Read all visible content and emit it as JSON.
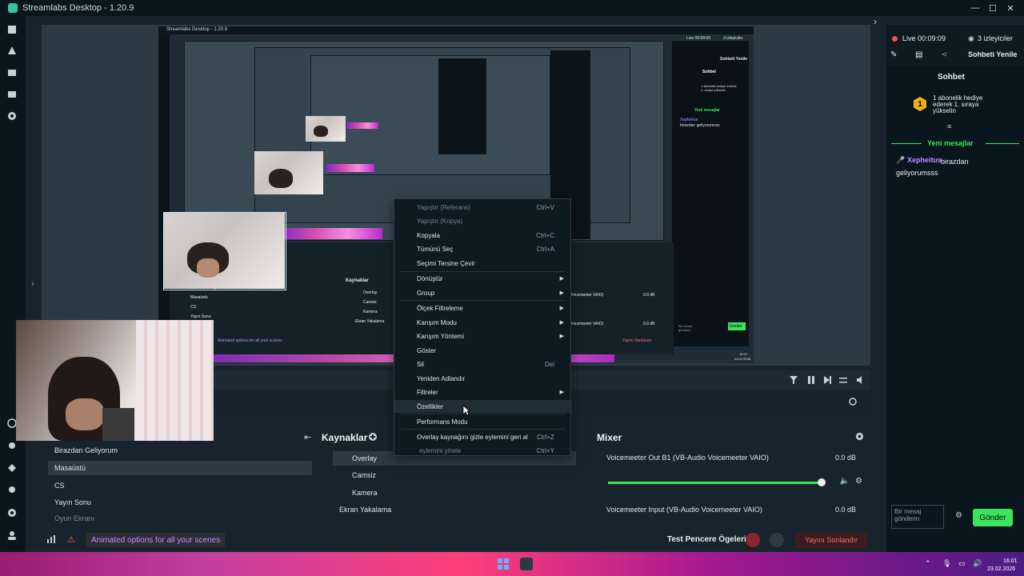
{
  "window": {
    "title": "Streamlabs Desktop - 1.20.9",
    "controls": [
      "—",
      "☐",
      "✕"
    ]
  },
  "nested_preview": {
    "title": "Streamlabs Desktop - 1.20.9",
    "chat_title": "Sohbet",
    "new_messages": "Yeni mesajlar",
    "message_user": "Xepheitus",
    "message_text": "birazdan geliyorumsss",
    "sources_title": "Kaynaklar",
    "sources": [
      "Overlay",
      "Camsiz",
      "Kamera",
      "Ekran Yakalama"
    ],
    "scenes": [
      "Birazdan Geliyor",
      "Masaüstü",
      "CS",
      "Yayın Sonu"
    ],
    "mixer_item_1": "Voicemeeter VAIO)",
    "mixer_item_2": "Voicemeeter VAIO)",
    "mixer_db": "0.0 dB",
    "live": "Live 00:09:09",
    "viewers": "3 izleyiciler",
    "refresh": "Sohbeti Yenile",
    "send": "Gönder",
    "end_stream": "Yayını Sonlandır",
    "animated": "Animated options for all your scenes",
    "message_placeholder": "Bir mesaj gönderin",
    "subscriber_gift": "1 abonelik hediye ederek 1. sıraya yükselin",
    "time": "16:01",
    "date": "23.02.2026"
  },
  "context_menu": {
    "items": [
      {
        "label": "Yapıştır (Referans)",
        "shortcut": "Ctrl+V",
        "disabled": true
      },
      {
        "label": "Yapıştır (Kopya)",
        "shortcut": "",
        "disabled": true
      },
      {
        "label": "Kopyala",
        "shortcut": "Ctrl+C"
      },
      {
        "label": "Tümünü Seç",
        "shortcut": "Ctrl+A"
      },
      {
        "label": "Seçimi Tersine Çevir",
        "shortcut": ""
      },
      {
        "label": "Dönüştür",
        "submenu": true
      },
      {
        "label": "Group",
        "submenu": true
      },
      {
        "label": "Ölçek Filtreleme",
        "submenu": true
      },
      {
        "label": "Karışım Modu",
        "submenu": true
      },
      {
        "label": "Karışım Yöntemi",
        "submenu": true
      },
      {
        "label": "Göster",
        "shortcut": ""
      },
      {
        "label": "Sil",
        "shortcut": "Del"
      },
      {
        "label": "Yeniden Adlandır",
        "shortcut": ""
      },
      {
        "label": "Filtreler",
        "submenu": true
      },
      {
        "label": "Özellikler",
        "shortcut": "",
        "hover": true
      },
      {
        "label": "Performans Modu",
        "shortcut": ""
      },
      {
        "label": "Overlay kaynağını gizle eylemini geri al",
        "shortcut": "Ctrl+Z"
      },
      {
        "label": "eylemini yinele",
        "shortcut": "Ctrl+Y",
        "disabled": true
      }
    ]
  },
  "scenes": {
    "title": "Kaynaklar",
    "items": [
      "Birazdan Geliyorum",
      "Masaüstü",
      "CS",
      "Yayın Sonu",
      "Oyun Ekranı"
    ]
  },
  "sources": {
    "title": "Kaynaklar",
    "items": [
      "Overlay",
      "Camsiz",
      "Kamera",
      "Ekran Yakalama"
    ]
  },
  "mixer": {
    "title": "Mixer",
    "channels": [
      {
        "name": "Voicemeeter Out B1 (VB-Audio Voicemeeter VAIO)",
        "db": "0.0 dB",
        "level": 0.96
      },
      {
        "name": "Voicemeeter Input (VB-Audio Voicemeeter VAIO)",
        "db": "0.0 dB"
      }
    ]
  },
  "footer": {
    "animated_label": "Animated options for all your scenes",
    "test_label": "Test Pencere Ögeleri",
    "end_stream_label": "Yayını Sonlandır"
  },
  "chat": {
    "live_label": "Live 00:09:09",
    "viewers": "3 izleyiciler",
    "refresh": "Sohbeti Yenile",
    "title": "Sohbet",
    "gift_badge": "1",
    "gift_text": "1 abonelik hediye ederek 1. sıraya yükselin",
    "new_messages": "Yeni mesajlar",
    "messages": [
      {
        "user": "Xepheitus",
        "text": "birazdan geliyorumsss"
      }
    ],
    "input_placeholder": "Bir mesaj gönderin",
    "send": "Gönder"
  },
  "taskbar": {
    "time": "16:01",
    "date": "23.02.2026"
  },
  "colors": {
    "accent": "#31c3a2",
    "send_green": "#3ae45b",
    "live_red": "#ff4d4d",
    "pink": "#c78bff"
  },
  "icons": [
    "minimize-icon",
    "maximize-icon",
    "close-icon",
    "editor-icon",
    "themes-icon",
    "store-icon",
    "library-icon",
    "live-icon",
    "pencil-icon",
    "share-icon",
    "eye-icon",
    "filter-icon",
    "pause-icon",
    "next-icon",
    "volume-icon",
    "refresh-icon",
    "mute-icon",
    "settings-icon",
    "mic-icon",
    "windows-start-icon"
  ]
}
